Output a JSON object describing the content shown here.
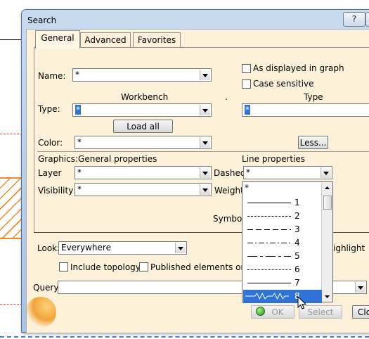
{
  "window": {
    "title": "Search",
    "help_button": "?"
  },
  "tabs": [
    {
      "label": "General",
      "active": true
    },
    {
      "label": "Advanced",
      "active": false
    },
    {
      "label": "Favorites",
      "active": false
    }
  ],
  "general": {
    "name_label": "Name:",
    "name_value": "*",
    "workbench_header": "Workbench",
    "type_header": "Type",
    "type_label": "Type:",
    "workbench_value": "*",
    "type_value": "*",
    "load_all_types": "Load all types",
    "color_label": "Color:",
    "color_value": "*",
    "less_button": "Less...",
    "as_displayed_label": "As displayed in graph",
    "as_displayed_checked": false,
    "case_sensitive_label": "Case sensitive",
    "case_sensitive_checked": false,
    "separator_dot": "."
  },
  "graphics": {
    "section_label": "Graphics:",
    "general_props_label": "General properties",
    "line_props_label": "Line properties",
    "layer_label": "Layer",
    "layer_value": "*",
    "visibility_label": "Visibility",
    "visibility_value": "*",
    "dashed_label": "Dashed",
    "dashed_value": "*",
    "weight_label": "Weight",
    "symbol_label": "Symbol"
  },
  "dashed_dropdown": {
    "items": [
      {
        "label": "*",
        "style": "none"
      },
      {
        "label": "1",
        "style": "solid"
      },
      {
        "label": "2",
        "style": "dashed"
      },
      {
        "label": "3",
        "style": "longdash"
      },
      {
        "label": "4",
        "style": "dashdot"
      },
      {
        "label": "5",
        "style": "longshort"
      },
      {
        "label": "6",
        "style": "dotted"
      },
      {
        "label": "7",
        "style": "solid"
      },
      {
        "label": "8",
        "style": "zigzag",
        "selected": true
      }
    ]
  },
  "lower": {
    "look_label": "Look:",
    "look_value": "Everywhere",
    "highlight_label": "ighlight",
    "include_topology_label": "Include topology",
    "include_topology_checked": false,
    "published_label": "Published elements only",
    "published_checked": false,
    "query_label": "Query:",
    "query_value": ""
  },
  "buttons": {
    "ok": "OK",
    "select": "Select",
    "close": "Clo"
  },
  "colors": {
    "selection": "#3072d6",
    "dialog_bg": "#fdf1da",
    "hatch": "#f08a2a",
    "axis_dash": "#d23c3c"
  }
}
